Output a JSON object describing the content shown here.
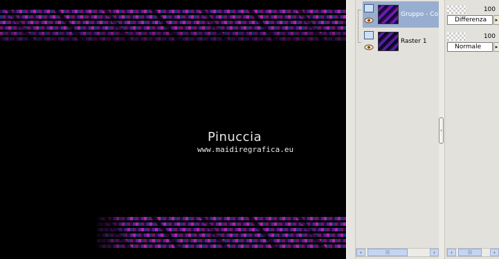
{
  "canvas": {
    "watermark_name": "Pinuccia",
    "watermark_url": "www.maidiregrafica.eu",
    "background_color": "#000000",
    "stripe_colors": [
      "#4a1a8c",
      "#7a28c8",
      "#c02aa8",
      "#2a48c0",
      "#8d1a70"
    ]
  },
  "layers": [
    {
      "name": "Gruppo - Copia",
      "selected": true
    },
    {
      "name": "Raster 1",
      "selected": false
    }
  ],
  "properties": [
    {
      "opacity": "100",
      "blend_mode": "Differenza"
    },
    {
      "opacity": "100",
      "blend_mode": "Normale"
    }
  ],
  "scrollbar": {
    "left_arrow": "‹",
    "right_arrow": "›",
    "grip": "|||"
  },
  "handle": {
    "glyph": "›"
  }
}
